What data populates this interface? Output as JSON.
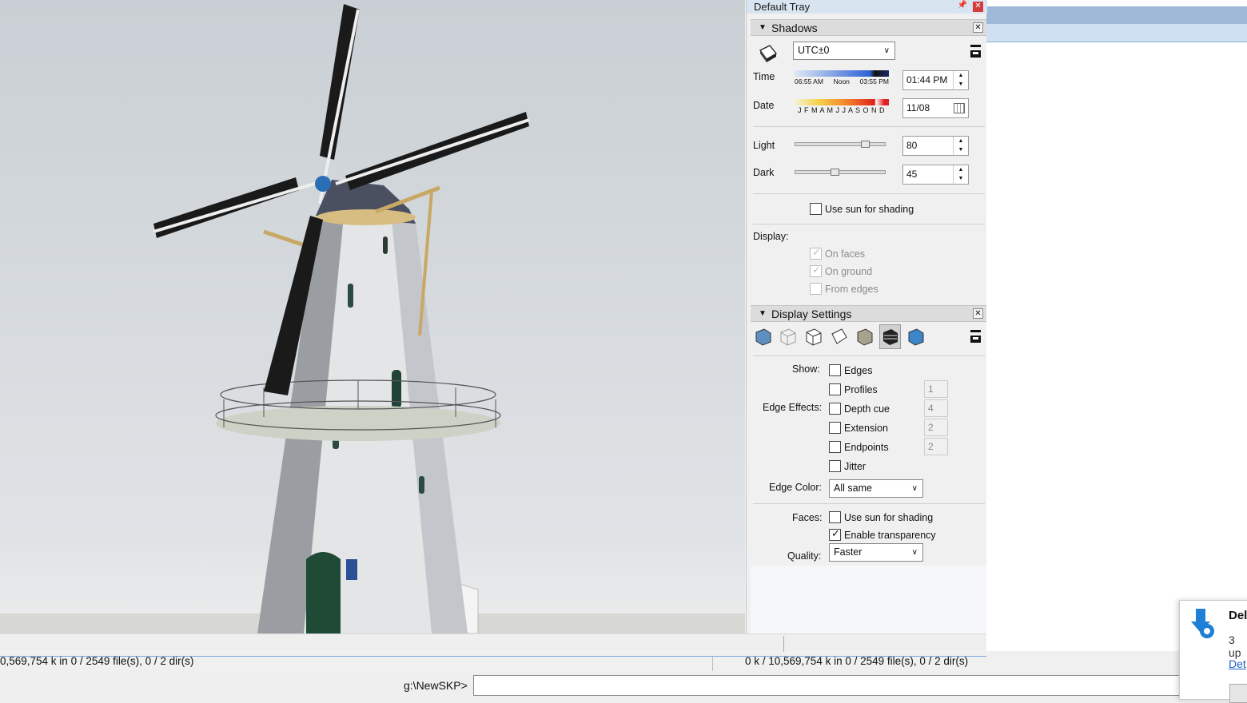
{
  "tray": {
    "title": "Default Tray",
    "pin_icon": "pin-icon",
    "close_icon": "close-icon"
  },
  "shadows": {
    "header": "Shadows",
    "timezone": "UTC±0",
    "time_label": "Time",
    "time_scale": [
      "06:55 AM",
      "Noon",
      "03:55 PM"
    ],
    "time_value": "01:44 PM",
    "date_label": "Date",
    "month_letters": "J F M A M J J A S O N D",
    "date_value": "11/08",
    "light_label": "Light",
    "light_value": "80",
    "light_level_pct": 80,
    "dark_label": "Dark",
    "dark_value": "45",
    "dark_level_pct": 45,
    "use_sun_label": "Use sun for shading",
    "use_sun_checked": false,
    "display_label": "Display:",
    "on_faces": "On faces",
    "on_ground": "On ground",
    "from_edges": "From edges"
  },
  "display_settings": {
    "header": "Display Settings",
    "show_label": "Show:",
    "edges": "Edges",
    "edge_effects_label": "Edge Effects:",
    "profiles": "Profiles",
    "profiles_num": "1",
    "depth_cue": "Depth cue",
    "depth_cue_num": "4",
    "extension": "Extension",
    "extension_num": "2",
    "endpoints": "Endpoints",
    "endpoints_num": "2",
    "jitter": "Jitter",
    "edge_color_label": "Edge Color:",
    "edge_color_value": "All same",
    "faces_label": "Faces:",
    "faces_use_sun": "Use sun for shading",
    "enable_transparency": "Enable transparency",
    "enable_transparency_checked": true,
    "quality_label": "Quality:",
    "quality_value": "Faster"
  },
  "status": {
    "left": "0,569,754 k in 0 / 2549 file(s), 0 / 2 dir(s)",
    "right": "0 k / 10,569,754 k in 0 / 2549 file(s), 0 / 2 dir(s)",
    "cmd_path": "g:\\NewSKP>"
  },
  "toast": {
    "title": "Del",
    "subtitle": "3 up",
    "link": "Det"
  },
  "colors": {
    "tray_title_bg": "#d9e4f1",
    "close_red": "#d43b3b",
    "link_blue": "#1a62c4"
  }
}
